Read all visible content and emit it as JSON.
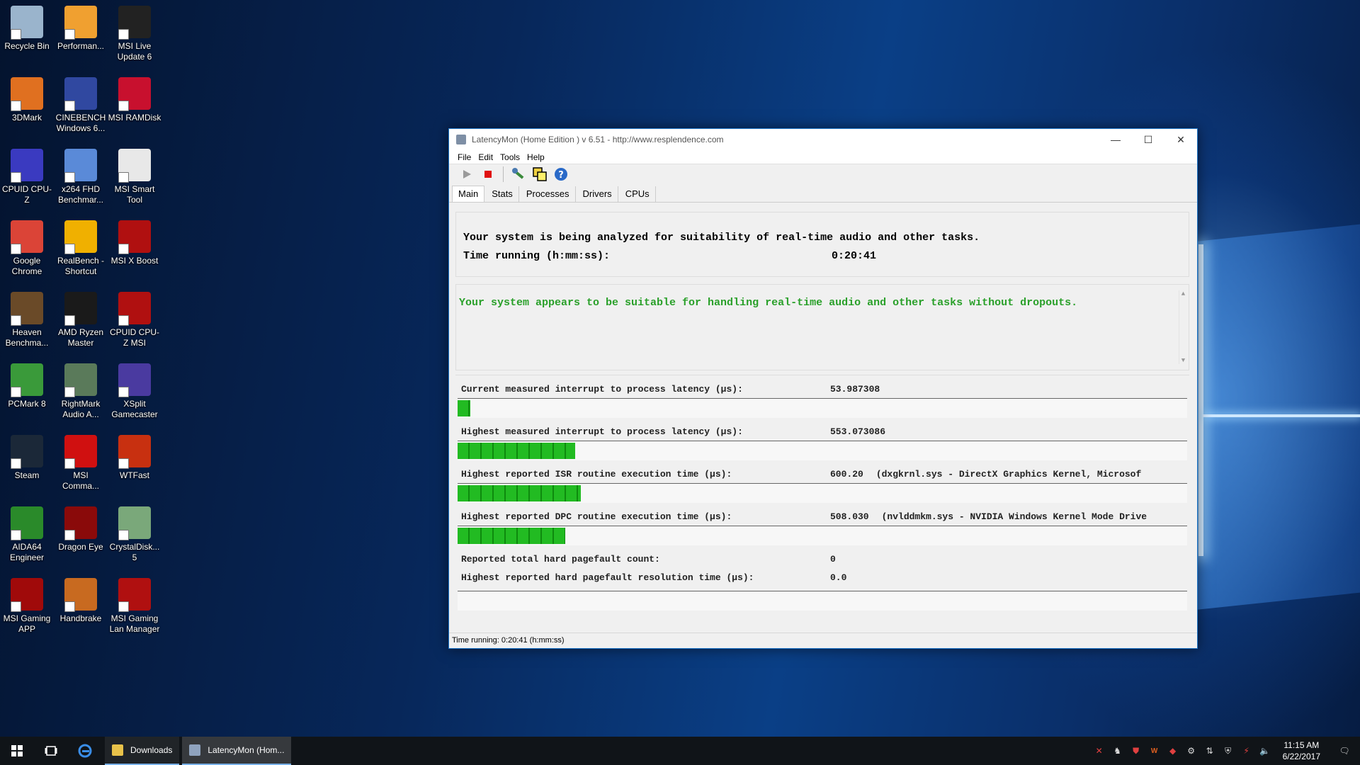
{
  "desktop": {
    "icons": [
      {
        "label": "Recycle Bin",
        "color": "#9ab4cc"
      },
      {
        "label": "Performan...",
        "color": "#f0a030"
      },
      {
        "label": "MSI Live Update 6",
        "color": "#222222"
      },
      {
        "label": "3DMark",
        "color": "#e07020"
      },
      {
        "label": "CINEBENCH Windows 6...",
        "color": "#3048a0"
      },
      {
        "label": "MSI RAMDisk",
        "color": "#c8102e"
      },
      {
        "label": "CPUID CPU-Z",
        "color": "#3a3ac0"
      },
      {
        "label": "x264 FHD Benchmar...",
        "color": "#5a8ad8"
      },
      {
        "label": "MSI Smart Tool",
        "color": "#e8e8e8"
      },
      {
        "label": "Google Chrome",
        "color": "#db4437"
      },
      {
        "label": "RealBench - Shortcut",
        "color": "#f0b000"
      },
      {
        "label": "MSI X Boost",
        "color": "#b01010"
      },
      {
        "label": "Heaven Benchma...",
        "color": "#6a4a28"
      },
      {
        "label": "AMD Ryzen Master",
        "color": "#1a1a1a"
      },
      {
        "label": "CPUID CPU-Z MSI",
        "color": "#b01010"
      },
      {
        "label": "PCMark 8",
        "color": "#3a9a3a"
      },
      {
        "label": "RightMark Audio A...",
        "color": "#5a7a5a"
      },
      {
        "label": "XSplit Gamecaster",
        "color": "#4a3aa0"
      },
      {
        "label": "Steam",
        "color": "#1b2838"
      },
      {
        "label": "MSI Comma...",
        "color": "#d01010"
      },
      {
        "label": "WTFast",
        "color": "#c83010"
      },
      {
        "label": "AIDA64 Engineer",
        "color": "#2a8a2a"
      },
      {
        "label": "Dragon Eye",
        "color": "#8a0a0a"
      },
      {
        "label": "CrystalDisk... 5",
        "color": "#7aa87a"
      },
      {
        "label": "MSI Gaming APP",
        "color": "#a00a0a"
      },
      {
        "label": "Handbrake",
        "color": "#c86a20"
      },
      {
        "label": "MSI Gaming Lan Manager",
        "color": "#b01010"
      }
    ]
  },
  "window": {
    "title": "LatencyMon  (Home Edition )  v 6.51 - http://www.resplendence.com",
    "controls": {
      "minimize": "—",
      "maximize": "☐",
      "close": "✕"
    },
    "menu": [
      "File",
      "Edit",
      "Tools",
      "Help"
    ],
    "tabs": [
      "Main",
      "Stats",
      "Processes",
      "Drivers",
      "CPUs"
    ],
    "main": {
      "analyzing": "Your system is being analyzed for suitability of real-time audio and other tasks.",
      "time_label": "Time running (h:mm:ss):",
      "time_value": "0:20:41",
      "verdict": "Your system appears to be suitable for handling real-time audio and other tasks without dropouts.",
      "success_color": "#2aa02a",
      "metrics": [
        {
          "label": "Current measured interrupt to process latency (µs):",
          "value": "53.987308",
          "extra": "",
          "bar": 0.017
        },
        {
          "label": "Highest measured interrupt to process latency (µs):",
          "value": "553.073086",
          "extra": "",
          "bar": 0.161
        },
        {
          "label": "Highest reported ISR routine execution time (µs):",
          "value": "600.20",
          "extra": "(dxgkrnl.sys - DirectX Graphics Kernel, Microsof",
          "bar": 0.169
        },
        {
          "label": "Highest reported DPC routine execution time (µs):",
          "value": "508.030",
          "extra": "(nvlddmkm.sys - NVIDIA Windows Kernel Mode Drive",
          "bar": 0.148
        }
      ],
      "pagefault_count_label": "Reported total hard pagefault count:",
      "pagefault_count_value": "0",
      "pagefault_time_label": "Highest reported hard pagefault resolution time (µs):",
      "pagefault_time_value": "0.0",
      "pagefault_bar": 0
    },
    "status": "Time running: 0:20:41  (h:mm:ss)"
  },
  "taskbar": {
    "start_icon": "windows-logo-icon",
    "tasks": [
      {
        "label": "Downloads",
        "active": false
      },
      {
        "label": "LatencyMon  (Hom...",
        "active": true
      }
    ],
    "time": "11:15 AM",
    "date": "6/22/2017"
  }
}
